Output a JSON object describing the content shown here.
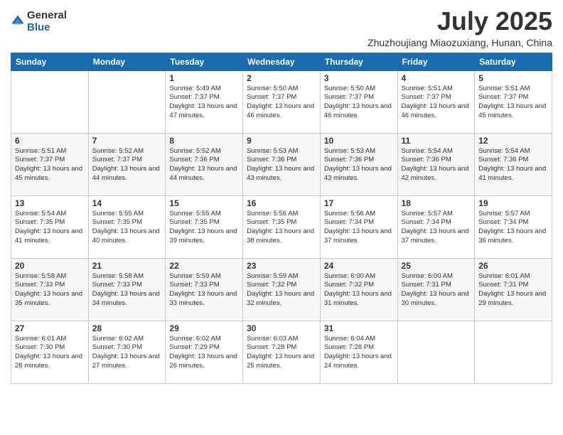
{
  "logo": {
    "general": "General",
    "blue": "Blue"
  },
  "header": {
    "month": "July 2025",
    "location": "Zhuzhoujiang Miaozuxiang, Hunan, China"
  },
  "weekdays": [
    "Sunday",
    "Monday",
    "Tuesday",
    "Wednesday",
    "Thursday",
    "Friday",
    "Saturday"
  ],
  "weeks": [
    [
      {
        "day": "",
        "info": ""
      },
      {
        "day": "",
        "info": ""
      },
      {
        "day": "1",
        "info": "Sunrise: 5:49 AM\nSunset: 7:37 PM\nDaylight: 13 hours and 47 minutes."
      },
      {
        "day": "2",
        "info": "Sunrise: 5:50 AM\nSunset: 7:37 PM\nDaylight: 13 hours and 46 minutes."
      },
      {
        "day": "3",
        "info": "Sunrise: 5:50 AM\nSunset: 7:37 PM\nDaylight: 13 hours and 46 minutes."
      },
      {
        "day": "4",
        "info": "Sunrise: 5:51 AM\nSunset: 7:37 PM\nDaylight: 13 hours and 46 minutes."
      },
      {
        "day": "5",
        "info": "Sunrise: 5:51 AM\nSunset: 7:37 PM\nDaylight: 13 hours and 45 minutes."
      }
    ],
    [
      {
        "day": "6",
        "info": "Sunrise: 5:51 AM\nSunset: 7:37 PM\nDaylight: 13 hours and 45 minutes."
      },
      {
        "day": "7",
        "info": "Sunrise: 5:52 AM\nSunset: 7:37 PM\nDaylight: 13 hours and 44 minutes."
      },
      {
        "day": "8",
        "info": "Sunrise: 5:52 AM\nSunset: 7:36 PM\nDaylight: 13 hours and 44 minutes."
      },
      {
        "day": "9",
        "info": "Sunrise: 5:53 AM\nSunset: 7:36 PM\nDaylight: 13 hours and 43 minutes."
      },
      {
        "day": "10",
        "info": "Sunrise: 5:53 AM\nSunset: 7:36 PM\nDaylight: 13 hours and 43 minutes."
      },
      {
        "day": "11",
        "info": "Sunrise: 5:54 AM\nSunset: 7:36 PM\nDaylight: 13 hours and 42 minutes."
      },
      {
        "day": "12",
        "info": "Sunrise: 5:54 AM\nSunset: 7:36 PM\nDaylight: 13 hours and 41 minutes."
      }
    ],
    [
      {
        "day": "13",
        "info": "Sunrise: 5:54 AM\nSunset: 7:35 PM\nDaylight: 13 hours and 41 minutes."
      },
      {
        "day": "14",
        "info": "Sunrise: 5:55 AM\nSunset: 7:35 PM\nDaylight: 13 hours and 40 minutes."
      },
      {
        "day": "15",
        "info": "Sunrise: 5:55 AM\nSunset: 7:35 PM\nDaylight: 13 hours and 39 minutes."
      },
      {
        "day": "16",
        "info": "Sunrise: 5:56 AM\nSunset: 7:35 PM\nDaylight: 13 hours and 38 minutes."
      },
      {
        "day": "17",
        "info": "Sunrise: 5:56 AM\nSunset: 7:34 PM\nDaylight: 13 hours and 37 minutes."
      },
      {
        "day": "18",
        "info": "Sunrise: 5:57 AM\nSunset: 7:34 PM\nDaylight: 13 hours and 37 minutes."
      },
      {
        "day": "19",
        "info": "Sunrise: 5:57 AM\nSunset: 7:34 PM\nDaylight: 13 hours and 36 minutes."
      }
    ],
    [
      {
        "day": "20",
        "info": "Sunrise: 5:58 AM\nSunset: 7:33 PM\nDaylight: 13 hours and 35 minutes."
      },
      {
        "day": "21",
        "info": "Sunrise: 5:58 AM\nSunset: 7:33 PM\nDaylight: 13 hours and 34 minutes."
      },
      {
        "day": "22",
        "info": "Sunrise: 5:59 AM\nSunset: 7:33 PM\nDaylight: 13 hours and 33 minutes."
      },
      {
        "day": "23",
        "info": "Sunrise: 5:59 AM\nSunset: 7:32 PM\nDaylight: 13 hours and 32 minutes."
      },
      {
        "day": "24",
        "info": "Sunrise: 6:00 AM\nSunset: 7:32 PM\nDaylight: 13 hours and 31 minutes."
      },
      {
        "day": "25",
        "info": "Sunrise: 6:00 AM\nSunset: 7:31 PM\nDaylight: 13 hours and 30 minutes."
      },
      {
        "day": "26",
        "info": "Sunrise: 6:01 AM\nSunset: 7:31 PM\nDaylight: 13 hours and 29 minutes."
      }
    ],
    [
      {
        "day": "27",
        "info": "Sunrise: 6:01 AM\nSunset: 7:30 PM\nDaylight: 13 hours and 28 minutes."
      },
      {
        "day": "28",
        "info": "Sunrise: 6:02 AM\nSunset: 7:30 PM\nDaylight: 13 hours and 27 minutes."
      },
      {
        "day": "29",
        "info": "Sunrise: 6:02 AM\nSunset: 7:29 PM\nDaylight: 13 hours and 26 minutes."
      },
      {
        "day": "30",
        "info": "Sunrise: 6:03 AM\nSunset: 7:28 PM\nDaylight: 13 hours and 25 minutes."
      },
      {
        "day": "31",
        "info": "Sunrise: 6:04 AM\nSunset: 7:28 PM\nDaylight: 13 hours and 24 minutes."
      },
      {
        "day": "",
        "info": ""
      },
      {
        "day": "",
        "info": ""
      }
    ]
  ]
}
